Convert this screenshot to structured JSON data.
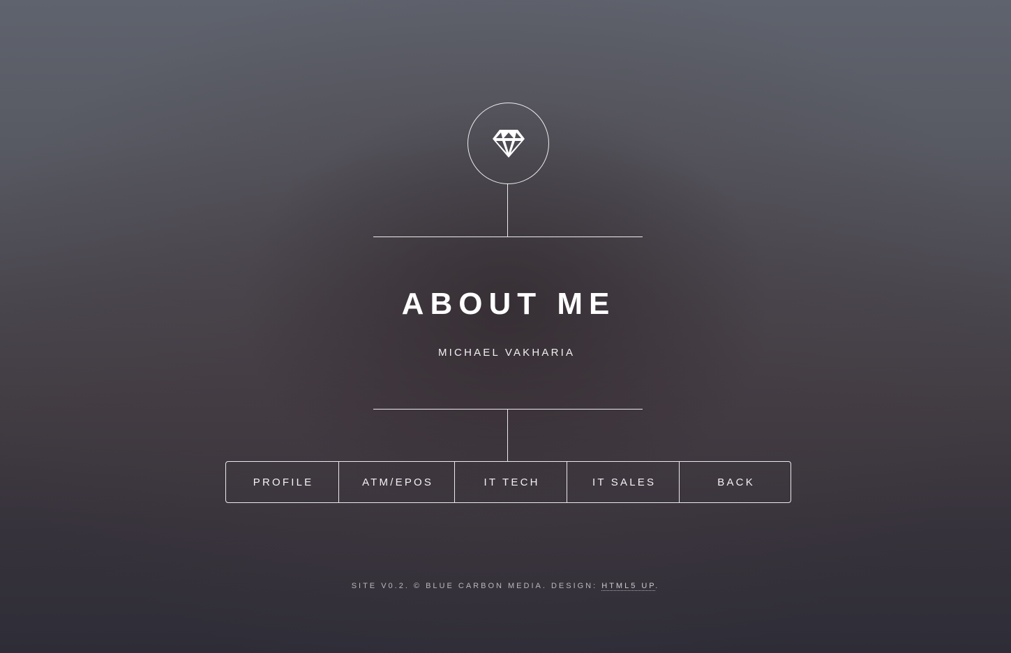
{
  "header": {
    "icon": "diamond-icon",
    "title": "ABOUT ME",
    "subtitle": "MICHAEL VAKHARIA"
  },
  "nav": {
    "items": [
      {
        "label": "PROFILE"
      },
      {
        "label": "ATM/EPOS"
      },
      {
        "label": "IT TECH"
      },
      {
        "label": "IT SALES"
      },
      {
        "label": "BACK"
      }
    ]
  },
  "footer": {
    "text": "SITE V0.2. © BLUE CARBON MEDIA. DESIGN: ",
    "link_label": "HTML5 UP",
    "suffix": "."
  },
  "colors": {
    "text": "#ffffff",
    "line": "#ffffff",
    "background_top": "#5f636d",
    "background_bottom": "#2e2d37"
  }
}
